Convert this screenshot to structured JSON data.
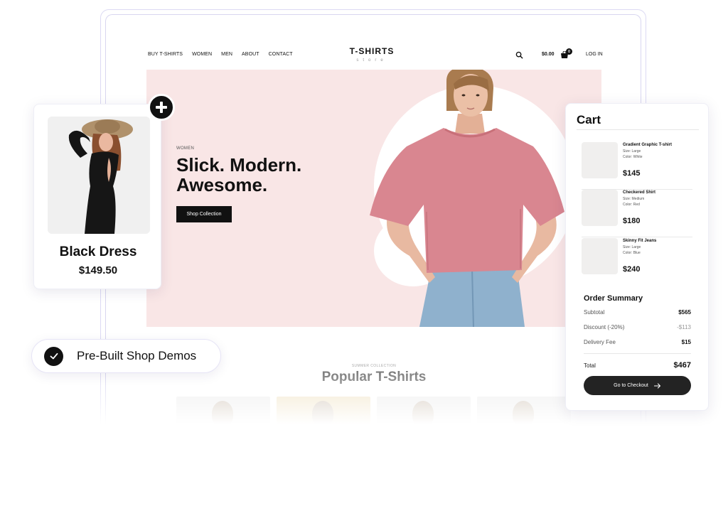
{
  "nav": {
    "links": [
      "BUY T-SHIRTS",
      "WOMEN",
      "MEN",
      "ABOUT",
      "CONTACT"
    ],
    "logo_title": "T-SHIRTS",
    "logo_sub": "store",
    "cart_total": "$0.00",
    "cart_count": "0",
    "login": "LOG IN"
  },
  "hero": {
    "kicker": "WOMEN",
    "title": "Slick. Modern. Awesome.",
    "button": "Shop Collection",
    "background": "#f9e6e6"
  },
  "popular": {
    "kicker": "SUMMER COLLECTION",
    "title": "Popular T-Shirts"
  },
  "product_card": {
    "name": "Black Dress",
    "price": "$149.50",
    "icon": "plus-icon"
  },
  "badge": {
    "label": "Pre-Built Shop Demos",
    "icon": "check-icon"
  },
  "cart": {
    "title": "Cart",
    "items": [
      {
        "name": "Gradient Graphic T-shirt",
        "size": "Size: Large",
        "color": "Color: White",
        "price": "$145"
      },
      {
        "name": "Checkered Shirt",
        "size": "Size: Medium",
        "color": "Color: Red",
        "price": "$180"
      },
      {
        "name": "Skinny Fit Jeans",
        "size": "Size: Large",
        "color": "Color: Blue",
        "price": "$240"
      }
    ],
    "summary": {
      "title": "Order Summary",
      "subtotal_label": "Subtotal",
      "subtotal": "$565",
      "discount_label": "Discount (-20%)",
      "discount": "-$113",
      "delivery_label": "Delivery Fee",
      "delivery": "$15",
      "total_label": "Total",
      "total": "$467"
    },
    "checkout": "Go to Checkout"
  },
  "colors": {
    "accent_dark": "#111111",
    "shirt_pink": "#d98690",
    "frame_border": "#dcdaf3"
  }
}
